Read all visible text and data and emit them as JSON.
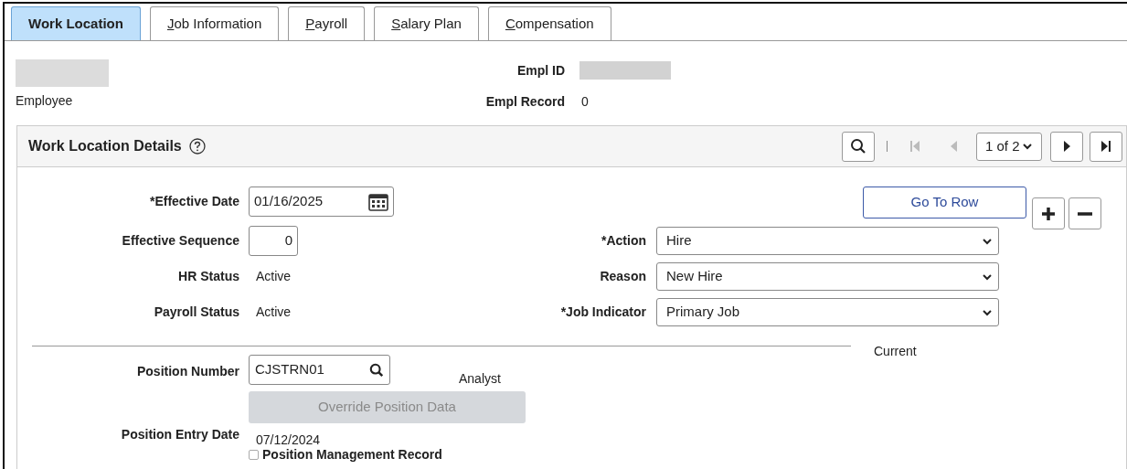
{
  "tabs": [
    {
      "label": "Work Location",
      "selected": true,
      "underline_first": false
    },
    {
      "label": "Job Information",
      "selected": false,
      "underline_first": true
    },
    {
      "label": "Payroll",
      "selected": false,
      "underline_first": true
    },
    {
      "label": "Salary Plan",
      "selected": false,
      "underline_first": true
    },
    {
      "label": "Compensation",
      "selected": false,
      "underline_first": true
    }
  ],
  "employee": {
    "name_redacted": true,
    "label": "Employee"
  },
  "empl_id": {
    "label": "Empl ID",
    "value_redacted": true
  },
  "empl_record": {
    "label": "Empl Record",
    "value": "0"
  },
  "panel": {
    "title": "Work Location Details",
    "pager": "1 of 2",
    "first_disabled": true,
    "prev_disabled": true,
    "go_to_row": "Go To Row"
  },
  "left_fields": [
    {
      "kind": "date",
      "label": "*Effective Date",
      "value": "01/16/2025"
    },
    {
      "kind": "number",
      "label": "Effective Sequence",
      "value": "0"
    },
    {
      "kind": "text",
      "label": "HR Status",
      "value": "Active"
    },
    {
      "kind": "text",
      "label": "Payroll Status",
      "value": "Active"
    }
  ],
  "right_fields": [
    {
      "label": "*Action",
      "value": "Hire"
    },
    {
      "label": "Reason",
      "value": "New Hire"
    },
    {
      "label": "*Job Indicator",
      "value": "Primary Job"
    }
  ],
  "current_label": "Current",
  "position": {
    "label": "Position Number",
    "value": "CJSTRN01",
    "description": "Analyst",
    "override_button": "Override Position Data",
    "override_disabled": true,
    "entry_date_label": "Position Entry Date",
    "entry_date": "07/12/2024",
    "mgmt_record_label": "Position Management Record",
    "mgmt_record_checked": false
  }
}
